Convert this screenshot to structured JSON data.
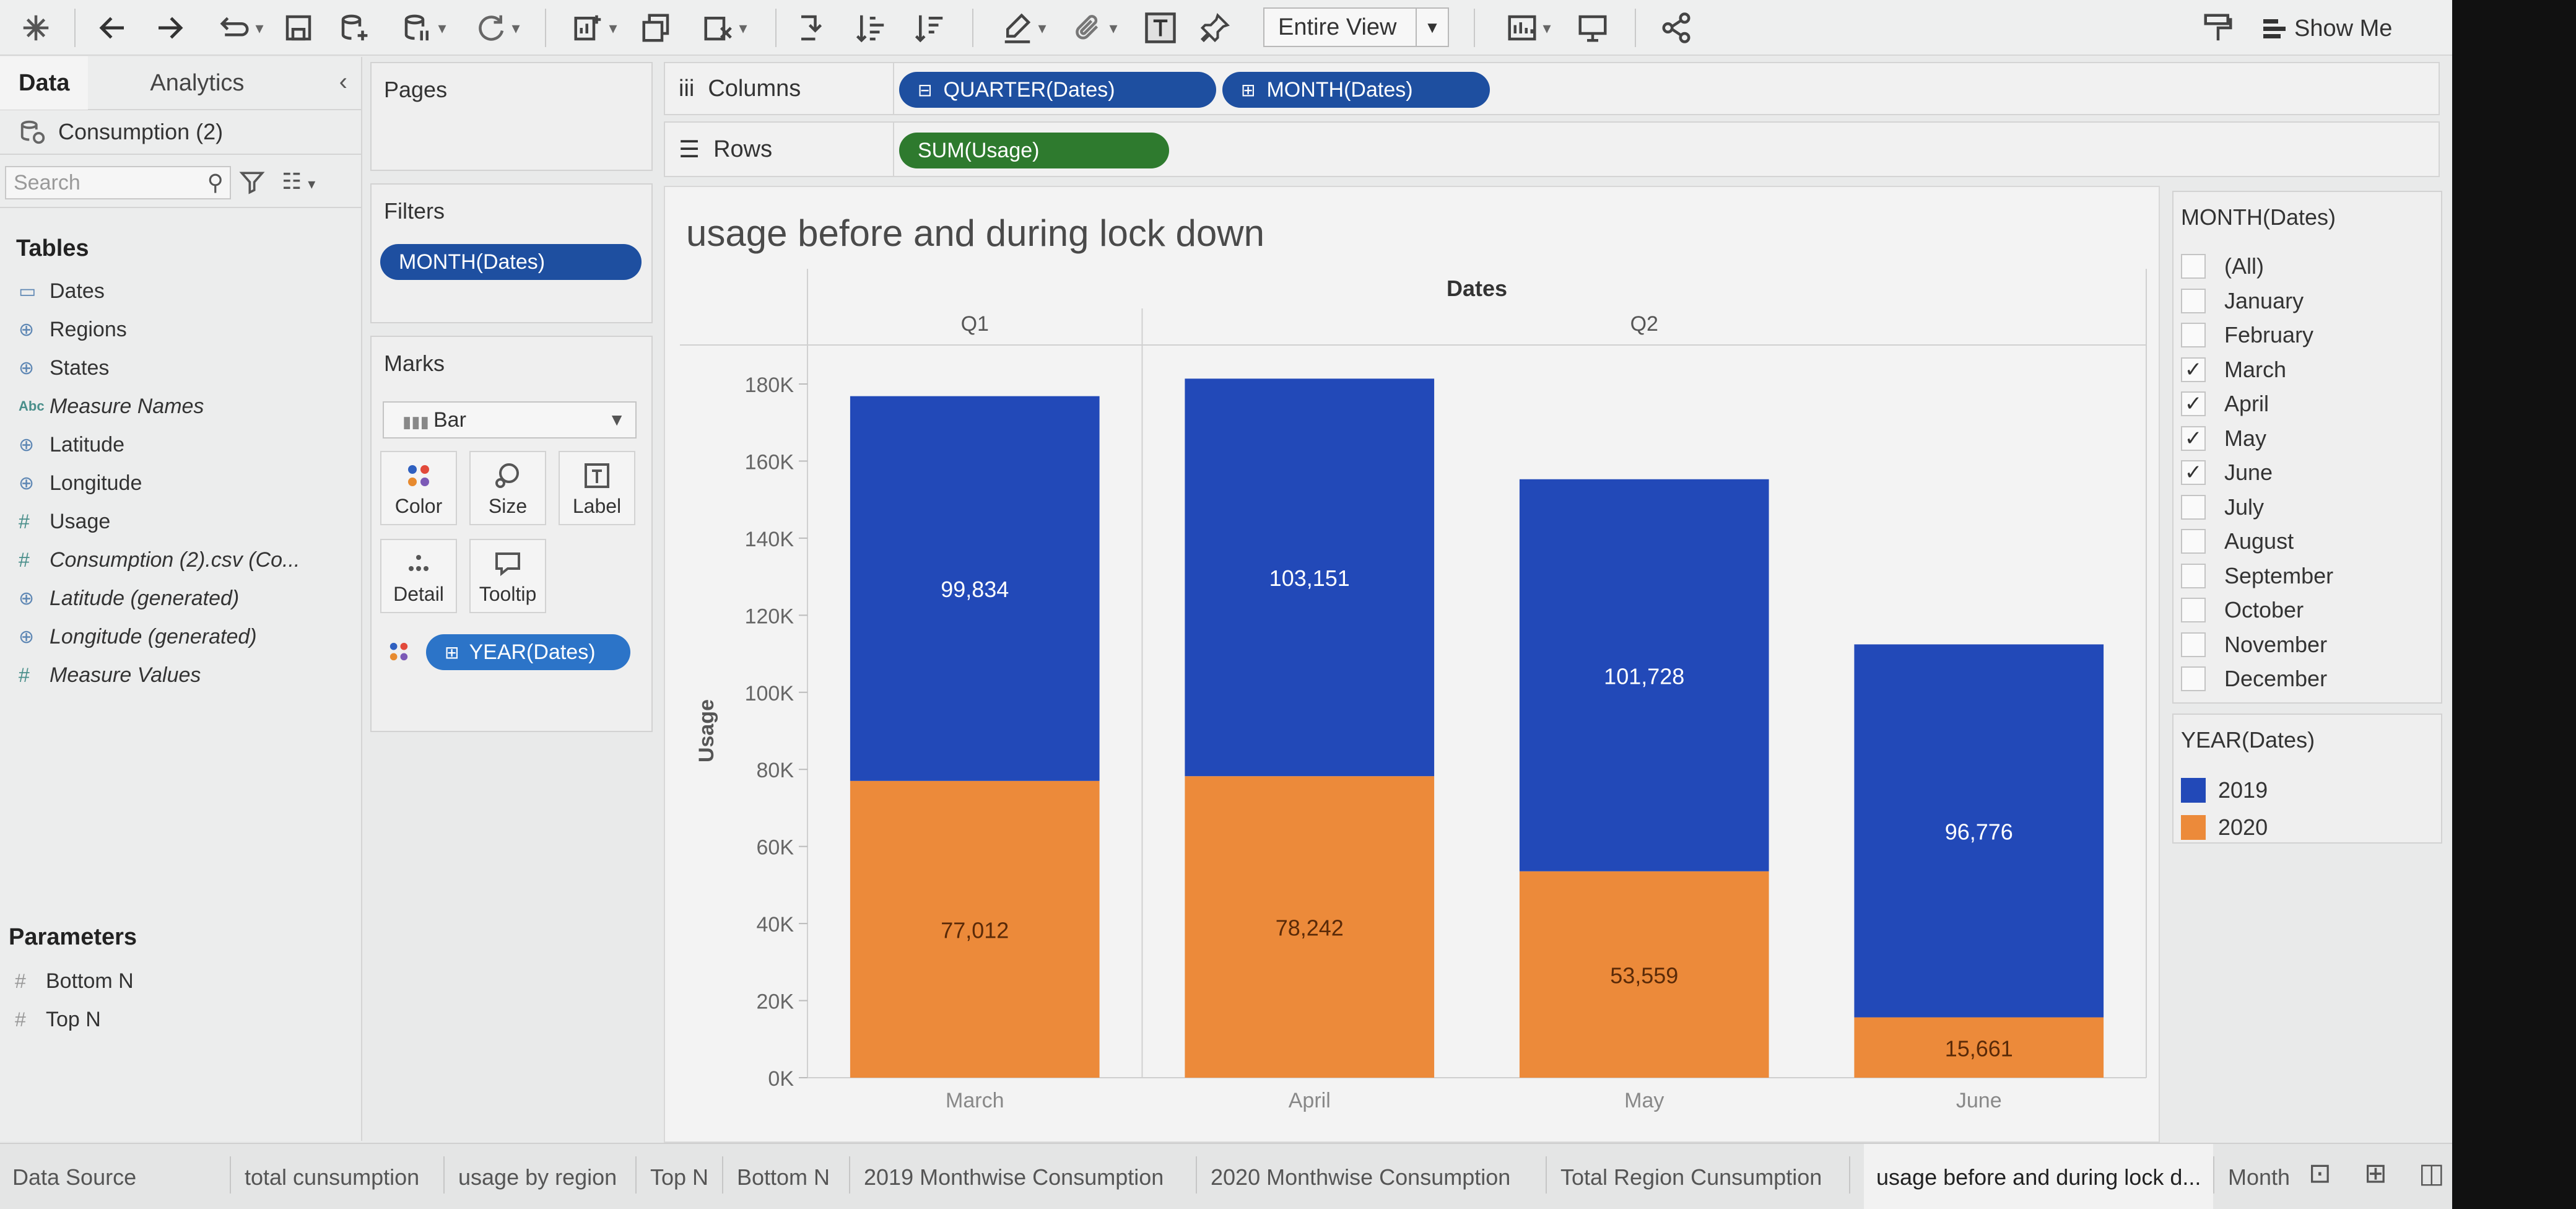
{
  "toolbar": {
    "fit_value": "Entire View",
    "show_me_label": "Show Me",
    "icons": [
      "tableau-logo-icon",
      "undo-icon",
      "redo-icon",
      "replay-icon",
      "save-icon",
      "new-datasource-icon",
      "pause-icon",
      "refresh-icon",
      "new-worksheet-icon",
      "duplicate-icon",
      "clear-sheet-icon",
      "swap-icon",
      "sort-ascending-icon",
      "sort-descending-icon",
      "highlight-icon",
      "group-icon",
      "text-label-icon",
      "pin-icon",
      "presentation-icon",
      "share-icon",
      "format-icon"
    ]
  },
  "data_pane": {
    "tab_data": "Data",
    "tab_analytics": "Analytics",
    "datasource_name": "Consumption (2)",
    "search_placeholder": "Search",
    "tables_heading": "Tables",
    "fields": [
      {
        "label": "Dates",
        "type": "date"
      },
      {
        "label": "Regions",
        "type": "geo"
      },
      {
        "label": "States",
        "type": "geo"
      },
      {
        "label": "Measure Names",
        "type": "abc"
      },
      {
        "label": "Latitude",
        "type": "geo"
      },
      {
        "label": "Longitude",
        "type": "geo"
      },
      {
        "label": "Usage",
        "type": "measure"
      },
      {
        "label": "Consumption (2).csv (Co...",
        "type": "measure"
      },
      {
        "label": "Latitude (generated)",
        "type": "geo"
      },
      {
        "label": "Longitude (generated)",
        "type": "geo"
      },
      {
        "label": "Measure Values",
        "type": "measure"
      }
    ],
    "parameters_heading": "Parameters",
    "parameters": [
      "Bottom N",
      "Top N"
    ]
  },
  "pages_card": {
    "title": "Pages"
  },
  "filters_card": {
    "title": "Filters",
    "pill": "MONTH(Dates)"
  },
  "marks_card": {
    "title": "Marks",
    "mark_type": "Bar",
    "buttons": [
      "Color",
      "Size",
      "Label",
      "Detail",
      "Tooltip"
    ],
    "color_pill": "YEAR(Dates)"
  },
  "shelves": {
    "columns_label": "Columns",
    "rows_label": "Rows",
    "column_pills": [
      "QUARTER(Dates)",
      "MONTH(Dates)"
    ],
    "row_pills": [
      "SUM(Usage)"
    ]
  },
  "legend_month": {
    "title": "MONTH(Dates)",
    "items": [
      {
        "label": "(All)",
        "checked": false
      },
      {
        "label": "January",
        "checked": false
      },
      {
        "label": "February",
        "checked": false
      },
      {
        "label": "March",
        "checked": true
      },
      {
        "label": "April",
        "checked": true
      },
      {
        "label": "May",
        "checked": true
      },
      {
        "label": "June",
        "checked": true
      },
      {
        "label": "July",
        "checked": false
      },
      {
        "label": "August",
        "checked": false
      },
      {
        "label": "September",
        "checked": false
      },
      {
        "label": "October",
        "checked": false
      },
      {
        "label": "November",
        "checked": false
      },
      {
        "label": "December",
        "checked": false
      }
    ]
  },
  "legend_year": {
    "title": "YEAR(Dates)",
    "items": [
      {
        "label": "2019",
        "color": "#2249b8"
      },
      {
        "label": "2020",
        "color": "#ec8a3a"
      }
    ]
  },
  "chart_data": {
    "type": "bar",
    "stacked": true,
    "title": "usage before and during lock down",
    "header_title": "Dates",
    "quarters": [
      {
        "label": "Q1",
        "categories": [
          "March"
        ]
      },
      {
        "label": "Q2",
        "categories": [
          "April",
          "May",
          "June"
        ]
      }
    ],
    "categories": [
      "March",
      "April",
      "May",
      "June"
    ],
    "series": [
      {
        "name": "2020",
        "color": "#ec8a3a",
        "values": [
          77012,
          78242,
          53559,
          15661
        ],
        "labels": [
          "77,012",
          "78,242",
          "53,559",
          "15,661"
        ]
      },
      {
        "name": "2019",
        "color": "#2249b8",
        "values": [
          99834,
          103151,
          101728,
          96776
        ],
        "labels": [
          "99,834",
          "103,151",
          "101,728",
          "96,776"
        ]
      }
    ],
    "ylabel": "Usage",
    "ylim": [
      0,
      180000
    ],
    "yticks": [
      0,
      20000,
      40000,
      60000,
      80000,
      100000,
      120000,
      140000,
      160000,
      180000
    ],
    "ytick_labels": [
      "0K",
      "20K",
      "40K",
      "60K",
      "80K",
      "100K",
      "120K",
      "140K",
      "160K",
      "180K"
    ],
    "grid": false
  },
  "sheet_tabs": [
    {
      "label": "Data Source",
      "active": false
    },
    {
      "label": "total cunsumption",
      "active": false
    },
    {
      "label": "usage by region",
      "active": false
    },
    {
      "label": "Top N",
      "active": false
    },
    {
      "label": "Bottom N",
      "active": false
    },
    {
      "label": "2019 Monthwise Consumption",
      "active": false
    },
    {
      "label": "2020 Monthwise Consumption",
      "active": false
    },
    {
      "label": "Total Region Cunsumption",
      "active": false
    },
    {
      "label": "usage before and during lock d...",
      "active": true
    },
    {
      "label": "Month",
      "active": false
    }
  ]
}
